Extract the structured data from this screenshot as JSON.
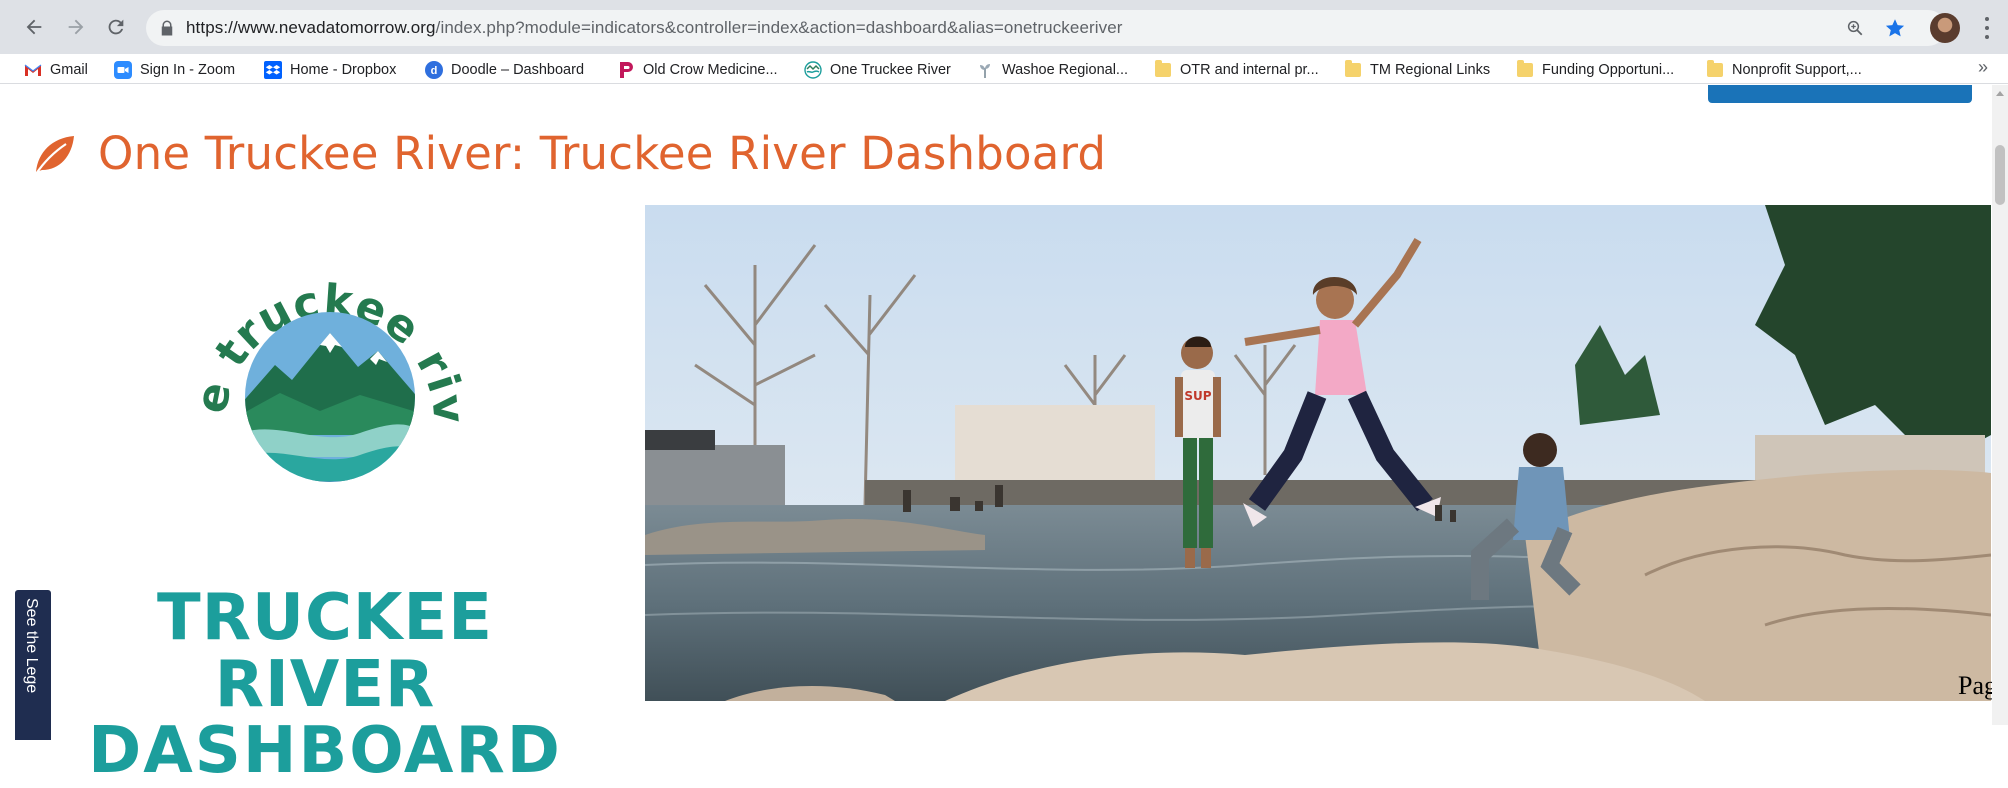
{
  "browser": {
    "url_host": "https://www.nevadatomorrow.org",
    "url_path": "/index.php?module=indicators&controller=index&action=dashboard&alias=onetruckeeriver",
    "icons": [
      "back-icon",
      "forward-icon",
      "reload-icon",
      "lock-icon",
      "zoom-icon",
      "star-icon",
      "profile-avatar",
      "menu-kebab-icon"
    ]
  },
  "bookmarks": [
    {
      "label": "Gmail",
      "icon": "gmail-icon"
    },
    {
      "label": "Sign In - Zoom",
      "icon": "zoom-app-icon"
    },
    {
      "label": "Home - Dropbox",
      "icon": "dropbox-icon"
    },
    {
      "label": "Doodle – Dashboard",
      "icon": "doodle-icon"
    },
    {
      "label": "Old Crow Medicine...",
      "icon": "bandcamp-icon"
    },
    {
      "label": "One Truckee River",
      "icon": "site-icon"
    },
    {
      "label": "Washoe Regional...",
      "icon": "plant-icon"
    },
    {
      "label": "OTR and internal pr...",
      "icon": "folder-icon"
    },
    {
      "label": "TM Regional Links",
      "icon": "folder-icon"
    },
    {
      "label": "Funding Opportuni...",
      "icon": "folder-icon"
    },
    {
      "label": "Nonprofit Support,...",
      "icon": "folder-icon"
    }
  ],
  "page": {
    "title": "One Truckee River: Truckee River Dashboard",
    "logo_ring_text": "one truckee river",
    "headline_line1": "TRUCKEE RIVER",
    "headline_line2": "DASHBOARD",
    "legend_tab": "See the Lege",
    "page_fragment": "Pag"
  },
  "colors": {
    "title": "#e0642f",
    "teal": "#1c9e9c",
    "legend_tab": "#1f2d50"
  }
}
